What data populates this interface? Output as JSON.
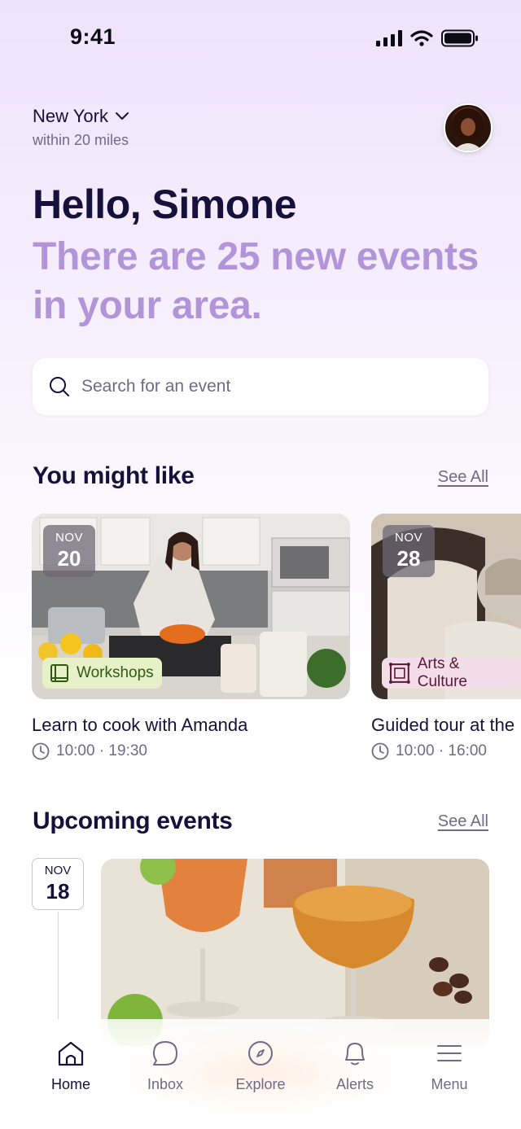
{
  "status_bar": {
    "time": "9:41"
  },
  "location": {
    "city": "New York",
    "radius": "within 20 miles"
  },
  "greeting": "Hello, Simone",
  "subheading": "There are 25 new events in your area.",
  "search": {
    "placeholder": "Search for an event"
  },
  "you_might_like": {
    "title": "You might like",
    "see_all": "See All",
    "cards": [
      {
        "month": "NOV",
        "day": "20",
        "tag": "Workshops",
        "tag_icon": "book-icon",
        "title": "Learn to cook with Amanda",
        "time": "10:00 · 19:30"
      },
      {
        "month": "NOV",
        "day": "28",
        "tag": "Arts & Culture",
        "tag_icon": "frame-icon",
        "title": "Guided tour at the",
        "time": "10:00 · 16:00"
      }
    ]
  },
  "upcoming": {
    "title": "Upcoming events",
    "see_all": "See All",
    "first": {
      "month": "NOV",
      "day": "18"
    }
  },
  "nav": {
    "items": [
      {
        "label": "Home",
        "icon": "home-icon",
        "active": true
      },
      {
        "label": "Inbox",
        "icon": "chat-icon"
      },
      {
        "label": "Explore",
        "icon": "compass-icon"
      },
      {
        "label": "Alerts",
        "icon": "bell-icon"
      },
      {
        "label": "Menu",
        "icon": "menu-icon"
      }
    ]
  },
  "colors": {
    "primary_text": "#16113a",
    "accent_lavender": "#b295d8",
    "muted_text": "#6f6a86",
    "workshops_tag_bg": "#e8f0c8",
    "workshops_tag_text": "#2f5a16",
    "arts_tag_bg": "#f3dde9",
    "arts_tag_text": "#5a1838"
  }
}
